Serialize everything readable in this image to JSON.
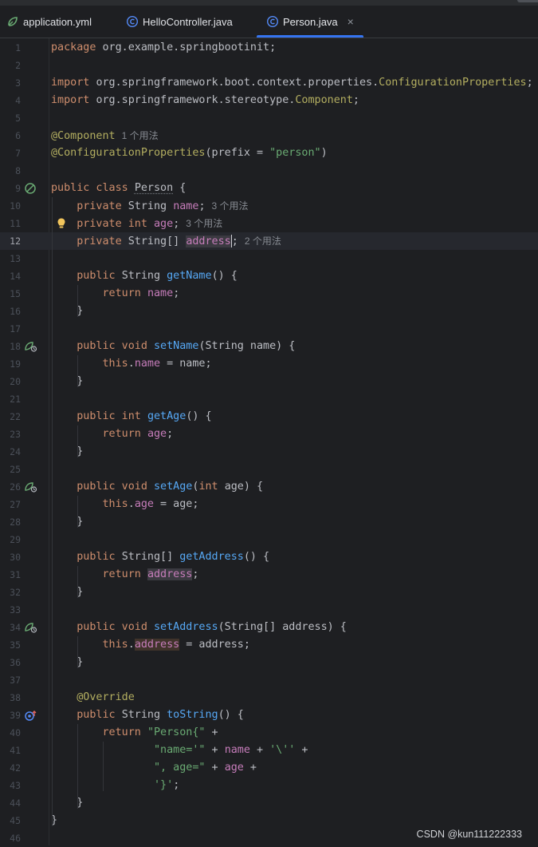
{
  "tabs": [
    {
      "label": "application.yml",
      "icon": "spring-yml-icon",
      "active": false
    },
    {
      "label": "HelloController.java",
      "icon": "java-class-icon",
      "active": false
    },
    {
      "label": "Person.java",
      "icon": "java-class-icon",
      "active": true,
      "close": "×"
    }
  ],
  "editor": {
    "current_line": 12,
    "line_numbers": [
      "1",
      "2",
      "3",
      "4",
      "5",
      "6",
      "7",
      "8",
      "9",
      "10",
      "11",
      "12",
      "13",
      "14",
      "15",
      "16",
      "17",
      "18",
      "19",
      "20",
      "21",
      "22",
      "23",
      "24",
      "25",
      "26",
      "27",
      "28",
      "29",
      "30",
      "31",
      "32",
      "33",
      "34",
      "35",
      "36",
      "37",
      "38",
      "39",
      "40",
      "41",
      "42",
      "43",
      "44",
      "45",
      "46"
    ],
    "lines": [
      [
        [
          "kw",
          "package "
        ],
        [
          "",
          "org.example.springbootinit;"
        ]
      ],
      [],
      [
        [
          "kw",
          "import "
        ],
        [
          "",
          "org.springframework.boot.context.properties."
        ],
        [
          "ann",
          "ConfigurationProperties"
        ],
        [
          "",
          ";"
        ]
      ],
      [
        [
          "kw",
          "import "
        ],
        [
          "",
          "org.springframework.stereotype."
        ],
        [
          "ann",
          "Component"
        ],
        [
          "",
          ";"
        ]
      ],
      [],
      [
        [
          "ann",
          "@Component"
        ],
        [
          "hint",
          "1 个用法"
        ]
      ],
      [
        [
          "ann",
          "@ConfigurationProperties"
        ],
        [
          "",
          "(prefix = "
        ],
        [
          "str",
          "\"person\""
        ],
        [
          "",
          ")"
        ]
      ],
      [],
      [
        [
          "kw",
          "public class "
        ],
        [
          "cls",
          "Person"
        ],
        [
          "",
          " {"
        ]
      ],
      [
        [
          "",
          "    "
        ],
        [
          "kw",
          "private "
        ],
        [
          "",
          "String "
        ],
        [
          "fld",
          "name"
        ],
        [
          "",
          ";"
        ],
        [
          "hint",
          "3 个用法"
        ]
      ],
      [
        [
          "",
          "    "
        ],
        [
          "kw",
          "private int "
        ],
        [
          "fld",
          "age"
        ],
        [
          "",
          ";"
        ],
        [
          "hint",
          "3 个用法"
        ]
      ],
      [
        [
          "",
          "    "
        ],
        [
          "kw",
          "private "
        ],
        [
          "",
          "String[] "
        ],
        [
          "fldhl",
          "address"
        ],
        [
          "caret",
          ""
        ],
        [
          "",
          ";"
        ],
        [
          "hint",
          "2 个用法"
        ]
      ],
      [],
      [
        [
          "",
          "    "
        ],
        [
          "kw",
          "public "
        ],
        [
          "",
          "String "
        ],
        [
          "mth",
          "getName"
        ],
        [
          "",
          "() {"
        ]
      ],
      [
        [
          "",
          "        "
        ],
        [
          "kw",
          "return "
        ],
        [
          "fld",
          "name"
        ],
        [
          "",
          ";"
        ]
      ],
      [
        [
          "",
          "    }"
        ]
      ],
      [],
      [
        [
          "",
          "    "
        ],
        [
          "kw",
          "public void "
        ],
        [
          "mth",
          "setName"
        ],
        [
          "",
          "(String name) {"
        ]
      ],
      [
        [
          "",
          "        "
        ],
        [
          "kw",
          "this"
        ],
        [
          "",
          "."
        ],
        [
          "fld",
          "name"
        ],
        [
          "",
          " = name;"
        ]
      ],
      [
        [
          "",
          "    }"
        ]
      ],
      [],
      [
        [
          "",
          "    "
        ],
        [
          "kw",
          "public int "
        ],
        [
          "mth",
          "getAge"
        ],
        [
          "",
          "() {"
        ]
      ],
      [
        [
          "",
          "        "
        ],
        [
          "kw",
          "return "
        ],
        [
          "fld",
          "age"
        ],
        [
          "",
          ";"
        ]
      ],
      [
        [
          "",
          "    }"
        ]
      ],
      [],
      [
        [
          "",
          "    "
        ],
        [
          "kw",
          "public void "
        ],
        [
          "mth",
          "setAge"
        ],
        [
          "",
          "("
        ],
        [
          "kw",
          "int "
        ],
        [
          "",
          "age) {"
        ]
      ],
      [
        [
          "",
          "        "
        ],
        [
          "kw",
          "this"
        ],
        [
          "",
          "."
        ],
        [
          "fld",
          "age"
        ],
        [
          "",
          " = age;"
        ]
      ],
      [
        [
          "",
          "    }"
        ]
      ],
      [],
      [
        [
          "",
          "    "
        ],
        [
          "kw",
          "public "
        ],
        [
          "",
          "String[] "
        ],
        [
          "mth",
          "getAddress"
        ],
        [
          "",
          "() {"
        ]
      ],
      [
        [
          "",
          "        "
        ],
        [
          "kw",
          "return "
        ],
        [
          "fldhl",
          "address"
        ],
        [
          "",
          ";"
        ]
      ],
      [
        [
          "",
          "    }"
        ]
      ],
      [],
      [
        [
          "",
          "    "
        ],
        [
          "kw",
          "public void "
        ],
        [
          "mth",
          "setAddress"
        ],
        [
          "",
          "(String[] address) {"
        ]
      ],
      [
        [
          "",
          "        "
        ],
        [
          "kw",
          "this"
        ],
        [
          "",
          "."
        ],
        [
          "fldhlw",
          "address"
        ],
        [
          "",
          " = address;"
        ]
      ],
      [
        [
          "",
          "    }"
        ]
      ],
      [],
      [
        [
          "",
          "    "
        ],
        [
          "ann",
          "@Override"
        ]
      ],
      [
        [
          "",
          "    "
        ],
        [
          "kw",
          "public "
        ],
        [
          "",
          "String "
        ],
        [
          "mth",
          "toString"
        ],
        [
          "",
          "() {"
        ]
      ],
      [
        [
          "",
          "        "
        ],
        [
          "kw",
          "return "
        ],
        [
          "str",
          "\"Person{\""
        ],
        [
          "",
          " +"
        ]
      ],
      [
        [
          "",
          "                "
        ],
        [
          "str",
          "\"name='\""
        ],
        [
          "",
          " + "
        ],
        [
          "fld",
          "name"
        ],
        [
          "",
          " + "
        ],
        [
          "str",
          "'\\''"
        ],
        [
          "",
          " +"
        ]
      ],
      [
        [
          "",
          "                "
        ],
        [
          "str",
          "\", age=\""
        ],
        [
          "",
          " + "
        ],
        [
          "fld",
          "age"
        ],
        [
          "",
          " +"
        ]
      ],
      [
        [
          "",
          "                "
        ],
        [
          "str",
          "'}'"
        ],
        [
          "",
          ";"
        ]
      ],
      [
        [
          "",
          "    }"
        ]
      ],
      [
        [
          "",
          "}"
        ]
      ],
      []
    ],
    "gutter_icons": {
      "9": "spring-bean-icon",
      "11": "lightbulb-icon",
      "18": "spring-setter-icon",
      "26": "spring-setter-icon",
      "34": "spring-setter-icon",
      "39": "override-method-icon"
    }
  },
  "colors": {
    "background": "#1e1f22",
    "keyword": "#cf8e6d",
    "annotation": "#b3ae60",
    "string": "#6aab73",
    "field": "#c77dbb",
    "method": "#56a8f5",
    "tab_underline": "#3574f0"
  },
  "watermark": "CSDN @kun111222333"
}
